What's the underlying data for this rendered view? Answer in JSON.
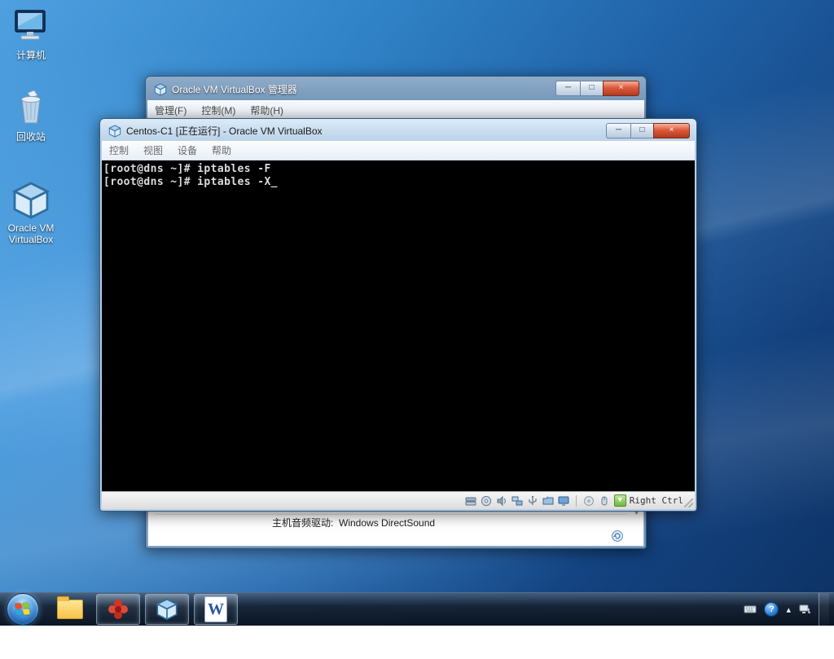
{
  "desktop": {
    "icons": [
      {
        "label": "计算机"
      },
      {
        "label": "回收站"
      },
      {
        "label": "Oracle VM VirtualBox"
      }
    ]
  },
  "manager_window": {
    "title": "Oracle VM VirtualBox 管理器",
    "menus": [
      "管理(F)",
      "控制(M)",
      "帮助(H)"
    ],
    "buttons": {
      "minimize": "─",
      "maximize": "□",
      "close": "×"
    },
    "audio_label": "主机音频驱动:",
    "audio_value": "Windows DirectSound",
    "scroll_glyph": "▼"
  },
  "vm_window": {
    "title": "Centos-C1 [正在运行] - Oracle VM VirtualBox",
    "menus": [
      "控制",
      "视图",
      "设备",
      "帮助"
    ],
    "buttons": {
      "minimize": "─",
      "maximize": "□",
      "close": "×"
    },
    "terminal": {
      "lines": [
        "[root@dns ~]# iptables -F",
        "[root@dns ~]# iptables -X"
      ],
      "cursor": "_"
    },
    "statusbar": {
      "hostkey_arrow": "▼",
      "host_key_label": "Right Ctrl"
    }
  },
  "taskbar": {
    "word_glyph": "W",
    "tray": {
      "help_glyph": "?",
      "chevron_glyph": "▴"
    }
  }
}
